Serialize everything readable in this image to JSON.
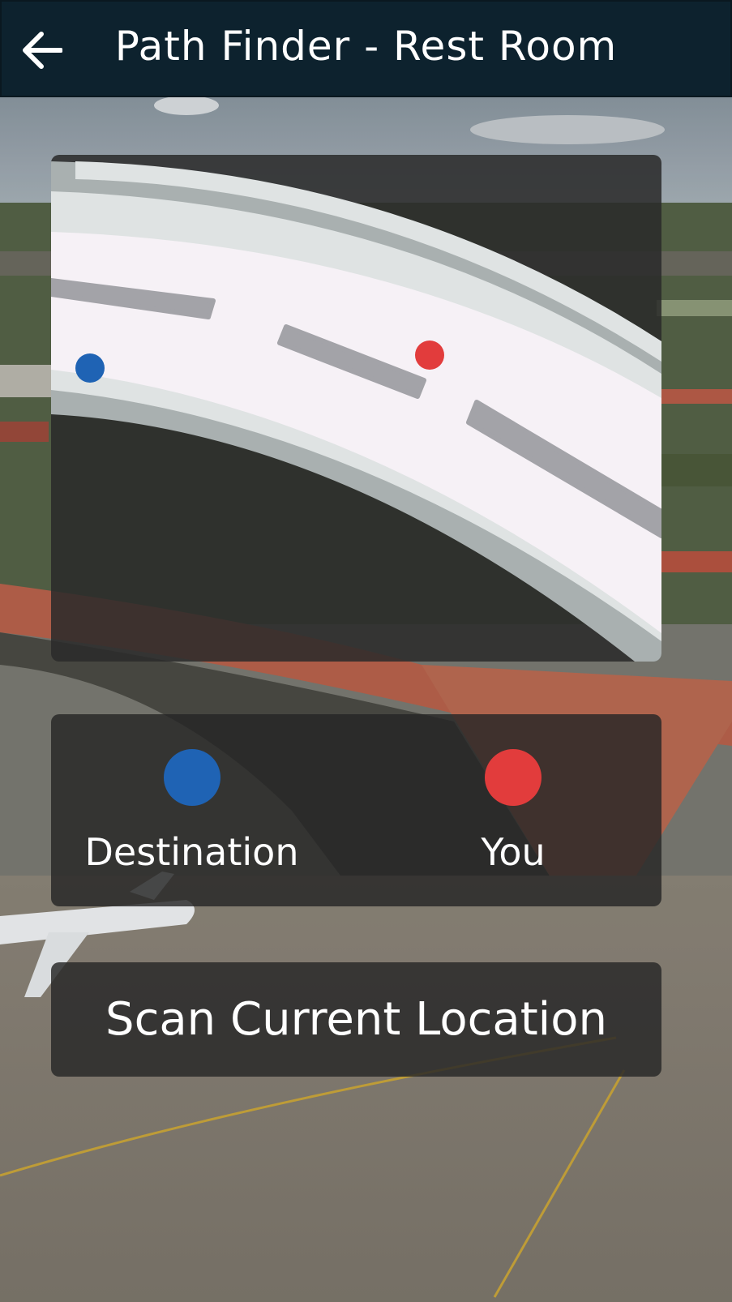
{
  "header": {
    "title": "Path Finder - Rest Room",
    "back_icon": "arrow-left-icon"
  },
  "map": {
    "destination_color": "#1f63b4",
    "you_color": "#e23c3c"
  },
  "legend": {
    "destination": {
      "label": "Destination",
      "color": "#1f63b4",
      "icon": "blue-dot-icon"
    },
    "you": {
      "label": "You",
      "color": "#e23c3c",
      "icon": "red-dot-icon"
    }
  },
  "actions": {
    "scan_label": "Scan Current Location"
  }
}
